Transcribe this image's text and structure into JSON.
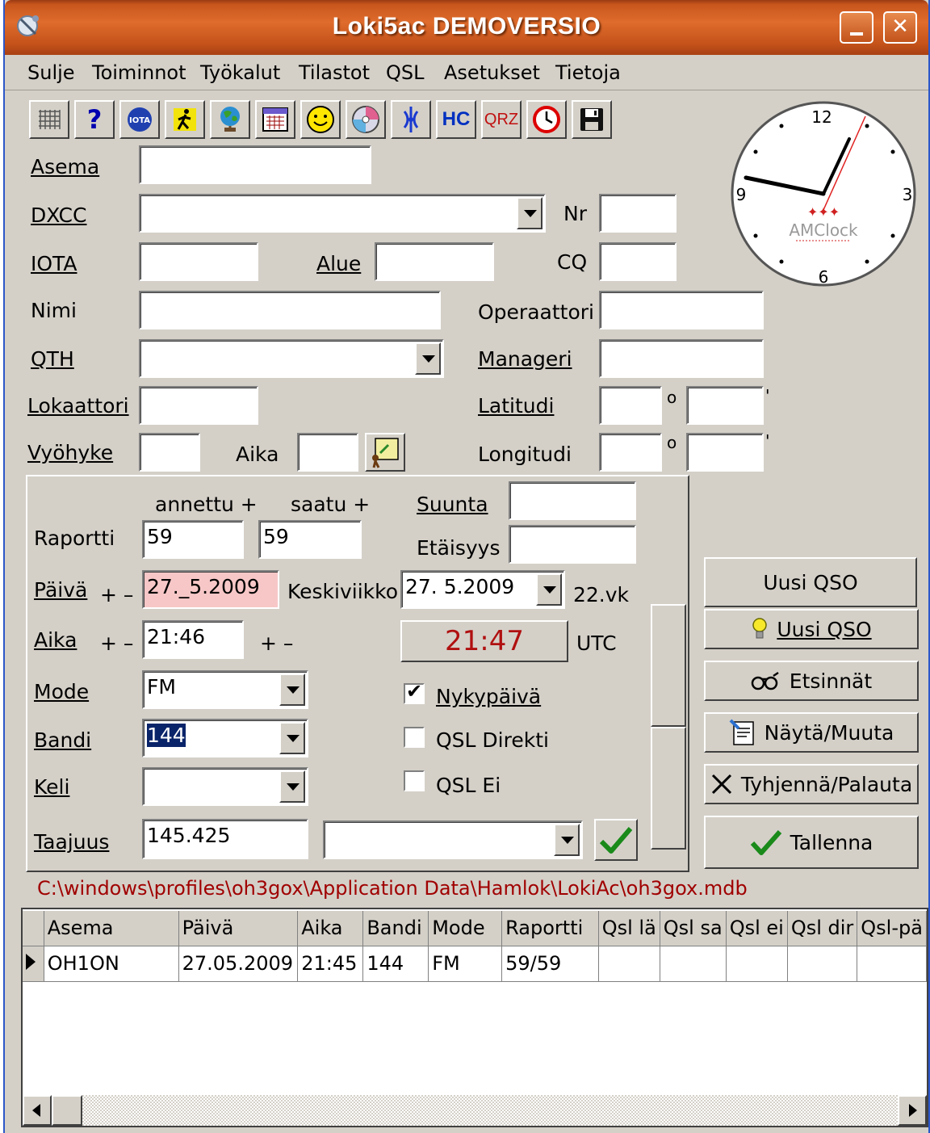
{
  "window": {
    "title": "Loki5ac DEMOVERSIO"
  },
  "menu": [
    "Sulje",
    "Toiminnot",
    "Työkalut",
    "Tilastot",
    "QSL",
    "Asetukset",
    "Tietoja"
  ],
  "toolbar": {
    "icons": [
      "grid-icon",
      "help-icon",
      "iota-icon",
      "runner-icon",
      "globe-icon",
      "calendar-icon",
      "smiley-icon",
      "cd-icon",
      "antenna-icon",
      "hc-icon",
      "qrz-icon",
      "clock-icon",
      "save-icon"
    ],
    "iota_text": "IOTA",
    "hc_text": "HC",
    "qrz_text": "QRZ"
  },
  "clock": {
    "brand": "AMClock",
    "n12": "12",
    "n3": "3",
    "n6": "6",
    "n9": "9"
  },
  "form": {
    "asema_label": "Asema",
    "asema_value": "",
    "dxcc_label": "DXCC",
    "dxcc_value": "",
    "nr_label": "Nr",
    "nr_value": "",
    "iota_label": "IOTA",
    "iota_value": "",
    "alue_label": "Alue",
    "alue_value": "",
    "cq_label": "CQ",
    "cq_value": "",
    "nimi_label": "Nimi",
    "nimi_value": "",
    "operaattori_label": "Operaattori",
    "operaattori_value": "",
    "qth_label": "QTH",
    "qth_value": "",
    "manageri_label": "Manageri",
    "manageri_value": "",
    "lokaattori_label": "Lokaattori",
    "lokaattori_value": "",
    "latitudi_label": "Latitudi",
    "vyohyke_label": "Vyöhyke",
    "vyohyke_value": "",
    "aika_label": "Aika",
    "aika_value": "",
    "longitudi_label": "Longitudi",
    "degree": "o",
    "minute": "'"
  },
  "qso": {
    "annettu": "annettu  +",
    "saatu": "saatu  +",
    "suunta_label": "Suunta",
    "suunta_value": "",
    "etaisyys_label": "Etäisyys",
    "etaisyys_value": "",
    "raportti_label": "Raportti",
    "raportti_sent": "59",
    "raportti_rcvd": "59",
    "paiva_label": "Päivä",
    "paiva_pm": "+ –",
    "paiva_value": "27._5.2009",
    "weekday": "Keskiviikko",
    "date_select": "27.  5.2009",
    "week": "22.vk",
    "aika_label": "Aika",
    "aika_pm": "+ –",
    "aika_value": "21:46",
    "aika_pm2": "+ –",
    "utc_time": "21:47",
    "utc_label": "UTC",
    "mode_label": "Mode",
    "mode_value": "FM",
    "bandi_label": "Bandi",
    "bandi_value": "144",
    "keli_label": "Keli",
    "keli_value": "",
    "taajuus_label": "Taajuus",
    "taajuus_value": "145.425",
    "nykypaiva": "Nykypäivä",
    "qsl_direkti": "QSL Direkti",
    "qsl_ei": "QSL Ei"
  },
  "checks": {
    "nykypaiva": true,
    "qsl_direkti": false,
    "qsl_ei": false
  },
  "actions": {
    "uusi_title": "Uusi QSO",
    "uusi": "Uusi QSO",
    "etsinnat": "Etsinnät",
    "nayta": "Näytä/Muuta",
    "tyhjenna": "Tyhjennä/Palauta",
    "tallenna": "Tallenna"
  },
  "db_path": "C:\\windows\\profiles\\oh3gox\\Application Data\\Hamlok\\LokiAc\\oh3gox.mdb",
  "table": {
    "columns": [
      "Asema",
      "Päivä",
      "Aika",
      "Bandi",
      "Mode",
      "Raportti",
      "Qsl lä",
      "Qsl sa",
      "Qsl ei",
      "Qsl dir",
      "Qsl-pä"
    ],
    "rows": [
      [
        "OH1ON",
        "27.05.2009",
        "21:45",
        "144",
        "FM",
        "59/59",
        "",
        "",
        "",
        "",
        ""
      ]
    ]
  },
  "colors": {
    "title_orange": "#c8561d",
    "path_red": "#a00000",
    "utc_red": "#b01010",
    "face": "#d4d0c8"
  }
}
